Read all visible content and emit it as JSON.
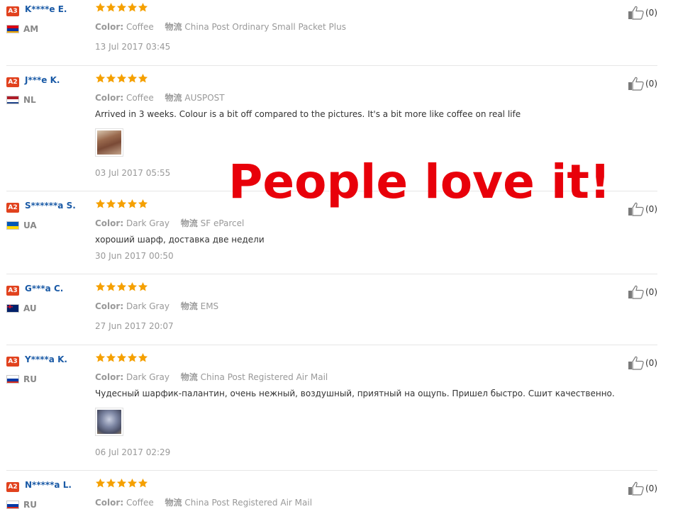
{
  "reviews": [
    {
      "level": "A3",
      "user": "K****e E.",
      "country": "AM",
      "flag": [
        "#d90012",
        "#0033a0",
        "#f2a800"
      ],
      "rating": 5,
      "color_label": "Color:",
      "color_value": "Coffee",
      "ship_label": "物流",
      "ship_value": "China Post Ordinary Small Packet Plus",
      "text": "",
      "has_photo": false,
      "date": "13 Jul 2017 03:45",
      "likes": "(0)"
    },
    {
      "level": "A2",
      "user": "J***e K.",
      "country": "NL",
      "flag": [
        "#ae1c28",
        "#ffffff",
        "#21468b"
      ],
      "rating": 5,
      "color_label": "Color:",
      "color_value": "Coffee",
      "ship_label": "物流",
      "ship_value": "AUSPOST",
      "text": "Arrived in 3 weeks. Colour is a bit off compared to the pictures. It's a bit more like coffee on real life",
      "has_photo": true,
      "date": "03 Jul 2017 05:55",
      "likes": "(0)"
    },
    {
      "level": "A2",
      "user": "S******a S.",
      "country": "UA",
      "flag": [
        "#0057b7",
        "#ffd700"
      ],
      "rating": 5,
      "color_label": "Color:",
      "color_value": "Dark Gray",
      "ship_label": "物流",
      "ship_value": "SF eParcel",
      "text": "хороший шарф, доставка две недели",
      "has_photo": false,
      "date": "30 Jun 2017 00:50",
      "likes": "(0)"
    },
    {
      "level": "A3",
      "user": "G***a C.",
      "country": "AU",
      "flag": [
        "#012169"
      ],
      "rating": 5,
      "color_label": "Color:",
      "color_value": "Dark Gray",
      "ship_label": "物流",
      "ship_value": "EMS",
      "text": "",
      "has_photo": false,
      "date": "27 Jun 2017 20:07",
      "likes": "(0)"
    },
    {
      "level": "A3",
      "user": "Y****a K.",
      "country": "RU",
      "flag": [
        "#ffffff",
        "#0039a6",
        "#d52b1e"
      ],
      "rating": 5,
      "color_label": "Color:",
      "color_value": "Dark Gray",
      "ship_label": "物流",
      "ship_value": "China Post Registered Air Mail",
      "text": "Чудесный шарфик-палантин, очень нежный, воздушный, приятный на ощупь. Пришел быстро. Сшит качественно.",
      "has_photo": true,
      "date": "06 Jul 2017 02:29",
      "likes": "(0)"
    },
    {
      "level": "A2",
      "user": "N*****a L.",
      "country": "RU",
      "flag": [
        "#ffffff",
        "#0039a6",
        "#d52b1e"
      ],
      "rating": 5,
      "color_label": "Color:",
      "color_value": "Coffee",
      "ship_label": "物流",
      "ship_value": "China Post Registered Air Mail",
      "text": "",
      "has_photo": false,
      "date": "",
      "likes": "(0)"
    }
  ],
  "overlay_text": "People love it!",
  "colors": {
    "star": "#f5a000",
    "username": "#1a5aa6",
    "badge": "#e1421e",
    "overlay": "#e8000a"
  }
}
